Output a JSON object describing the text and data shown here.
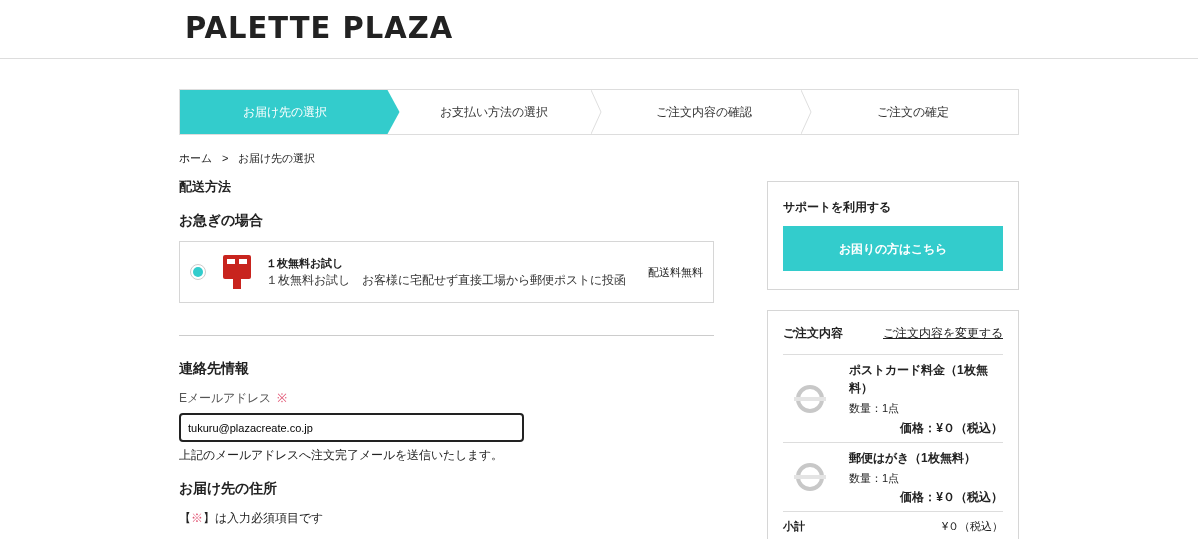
{
  "logo": "PALETTE PLAZA",
  "steps": [
    {
      "label": "お届け先の選択",
      "selected": true
    },
    {
      "label": "お支払い方法の選択",
      "selected": false
    },
    {
      "label": "ご注文内容の確認",
      "selected": false
    },
    {
      "label": "ご注文の確定",
      "selected": false
    }
  ],
  "breadcrumb": [
    "ホーム",
    "お届け先の選択"
  ],
  "breadcrumb_separator": ">",
  "shipping": {
    "heading": "配送方法",
    "subheading": "お急ぎの場合",
    "options": [
      {
        "selected": true,
        "title": "１枚無料お試し",
        "description": "１枚無料お試し　お客様に宅配せず直接工場から郵便ポストに投函",
        "fee": "配送料無料"
      }
    ]
  },
  "contact": {
    "heading": "連絡先情報",
    "email_label": "Eメールアドレス",
    "required_mark": "※",
    "email_value": "tukuru@plazacreate.co.jp",
    "note": "上記のメールアドレスへ注文完了メールを送信いたします。"
  },
  "address": {
    "heading": "お届け先の住所",
    "required_note_open": "【",
    "required_note_mark": "※",
    "required_note_rest": "】は入力必須項目です"
  },
  "support": {
    "title": "サポートを利用する",
    "button": "お困りの方はこちら"
  },
  "order": {
    "title": "ご注文内容",
    "change_link": "ご注文内容を変更する",
    "items": [
      {
        "name": "ポストカード料金（1枚無料）",
        "quantity": "数量：1点",
        "price": "価格：¥０（税込）"
      },
      {
        "name": "郵便はがき（1枚無料）",
        "quantity": "数量：1点",
        "price": "価格：¥０（税込）"
      }
    ],
    "subtotal_label": "小計",
    "subtotal": "¥０（税込）"
  }
}
